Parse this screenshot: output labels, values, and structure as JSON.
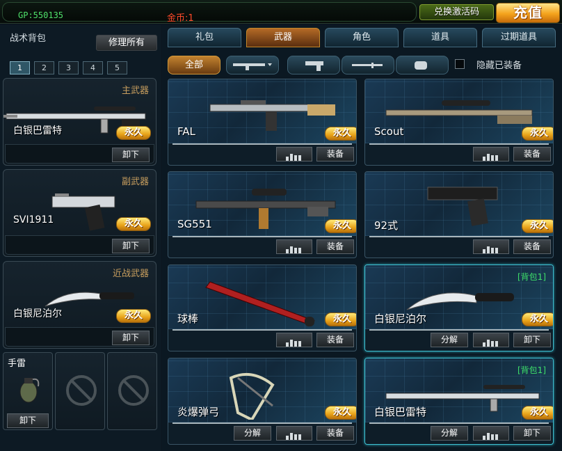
{
  "header": {
    "gp": "GP:550135",
    "gold": "金币:1",
    "redeem_label": "兑换激活码",
    "recharge_label": "充值"
  },
  "backpack": {
    "title": "战术背包",
    "repair_all": "修理所有",
    "pages": [
      "1",
      "2",
      "3",
      "4",
      "5"
    ],
    "slots": [
      {
        "header": "主武器",
        "name": "白银巴雷特",
        "status": "永久",
        "unequip": "卸下"
      },
      {
        "header": "副武器",
        "name": "SVI1911",
        "status": "永久",
        "unequip": "卸下"
      },
      {
        "header": "近战武器",
        "name": "白银尼泊尔",
        "status": "永久",
        "unequip": "卸下"
      }
    ],
    "grenade": {
      "label": "手雷",
      "unequip": "卸下"
    }
  },
  "tabs": [
    "礼包",
    "武器",
    "角色",
    "道具",
    "过期道具"
  ],
  "filters": {
    "all_label": "全部",
    "icons": [
      "rifle-icon",
      "pistol-icon",
      "knife-icon",
      "grenade-icon"
    ],
    "hide_equipped": "隐藏已装备"
  },
  "items": [
    {
      "name": "FAL",
      "status": "永久",
      "equip": "装备",
      "icon": "fal-rifle"
    },
    {
      "name": "Scout",
      "status": "永久",
      "equip": "装备",
      "icon": "scout-sniper"
    },
    {
      "name": "SG551",
      "status": "永久",
      "equip": "装备",
      "icon": "sg551-rifle"
    },
    {
      "name": "92式",
      "status": "永久",
      "equip": "装备",
      "icon": "type92-pistol"
    },
    {
      "name": "球棒",
      "status": "永久",
      "equip": "装备",
      "icon": "baseball-bat"
    },
    {
      "name": "白银尼泊尔",
      "status": "永久",
      "bag": "[背包1]",
      "decompose": "分解",
      "unequip": "卸下",
      "icon": "silver-kukri"
    },
    {
      "name": "炎爆弹弓",
      "status": "永久",
      "decompose": "分解",
      "equip": "装备",
      "icon": "slingshot"
    },
    {
      "name": "白银巴雷特",
      "status": "永久",
      "bag": "[背包1]",
      "decompose": "分解",
      "unequip": "卸下",
      "icon": "silver-barrett"
    }
  ]
}
